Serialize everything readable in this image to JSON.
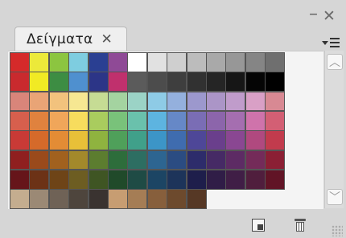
{
  "window": {
    "minimize_glyph": "–",
    "close_glyph": "✕"
  },
  "tab": {
    "label": "Δείγματα",
    "close_glyph": "✕"
  },
  "icons": {
    "panel_menu": "panel-menu-icon",
    "new_swatch": "new-swatch-icon",
    "delete_swatch": "trash-icon",
    "scroll_up": "chevron-up-icon",
    "scroll_down": "chevron-down-icon"
  },
  "scrollbar": {
    "up_glyph": "︿",
    "down_glyph": "﹀"
  },
  "swatch_rows": [
    [
      "#d52a2a",
      "#ece93a",
      "#8cc540",
      "#7ecde0",
      "#2a3f92",
      "#8f4a96",
      "#ffffff",
      "#e1e1e1",
      "#cfcfcf",
      "#bcbcbc",
      "#a9a9a9",
      "#979797",
      "#858585",
      "#6f6f6f"
    ],
    [
      "#c92a2e",
      "#f1ea24",
      "#3d8d43",
      "#4f90cf",
      "#2c3587",
      "#c0306d",
      "#5b5b5b",
      "#4c4c4c",
      "#3e3e3e",
      "#313131",
      "#252525",
      "#161616",
      "#050505",
      "#000000"
    ],
    [
      "#d9857a",
      "#e9a476",
      "#f2c27d",
      "#f6e792",
      "#c6dc94",
      "#a4d3a0",
      "#9bd3c6",
      "#8ecbe6",
      "#94b0dd",
      "#9c98cd",
      "#ab95c7",
      "#c09ccb",
      "#d9a0c6",
      "#d88993"
    ],
    [
      "#d75f4d",
      "#e0823e",
      "#f0a65a",
      "#f7dc5d",
      "#a9cc5e",
      "#79c27a",
      "#6ac1ac",
      "#5db4e0",
      "#6688c7",
      "#7a6db5",
      "#8c65ab",
      "#a56eb0",
      "#cf73ab",
      "#d35f74"
    ],
    [
      "#c93a36",
      "#d56a2a",
      "#e38c35",
      "#e8c038",
      "#8fb33f",
      "#4fa05a",
      "#40a08a",
      "#3c95c7",
      "#3f6caf",
      "#4e4798",
      "#6a3f8c",
      "#8a4792",
      "#b0497f",
      "#c23b4d"
    ],
    [
      "#8f1f1f",
      "#9a4a1b",
      "#a1611e",
      "#a3892b",
      "#5c7d2f",
      "#2d6d3b",
      "#2d6e62",
      "#2d6591",
      "#2b4c82",
      "#2d2c6b",
      "#462a65",
      "#5d2b64",
      "#742b59",
      "#8b1f34"
    ],
    [
      "#66151a",
      "#6c3216",
      "#6e4417",
      "#6d5d22",
      "#3f5523",
      "#204a2a",
      "#1f4b45",
      "#1c4564",
      "#1d345a",
      "#1e1e4b",
      "#301d47",
      "#401e46",
      "#501e3d",
      "#611426"
    ],
    [
      "#c4ad8f",
      "#9b8975",
      "#6f6256",
      "#4e453d",
      "#3a3330",
      "#c79d72",
      "#a57d55",
      "#875f3c",
      "#6d4a2d",
      "#563825",
      "",
      "",
      "",
      ""
    ]
  ]
}
